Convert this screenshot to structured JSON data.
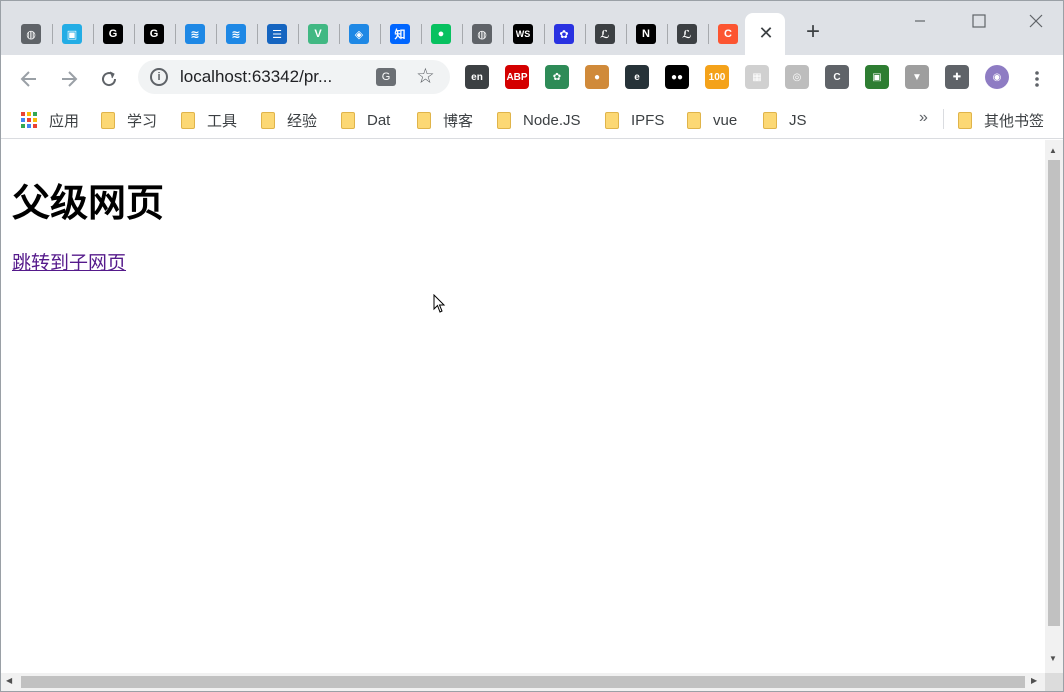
{
  "browser": {
    "tabs": [
      {
        "icon": "globe-icon",
        "color": "#5f6368",
        "glyph": "◍"
      },
      {
        "icon": "bilibili-icon",
        "color": "#23ade5",
        "glyph": "▣"
      },
      {
        "icon": "github-icon",
        "color": "#000000",
        "glyph": "G"
      },
      {
        "icon": "github-icon",
        "color": "#000000",
        "glyph": "G"
      },
      {
        "icon": "layers-icon",
        "color": "#1e88e5",
        "glyph": "≋"
      },
      {
        "icon": "layers-icon",
        "color": "#1e88e5",
        "glyph": "≋"
      },
      {
        "icon": "list-icon",
        "color": "#1565c0",
        "glyph": "☰"
      },
      {
        "icon": "vue-icon",
        "color": "#41b883",
        "glyph": "V"
      },
      {
        "icon": "cube-icon",
        "color": "#1e88e5",
        "glyph": "◈"
      },
      {
        "icon": "zhihu-icon",
        "color": "#0066ff",
        "glyph": "知"
      },
      {
        "icon": "wechat-icon",
        "color": "#07c160",
        "glyph": "●"
      },
      {
        "icon": "globe-icon",
        "color": "#5f6368",
        "glyph": "◍"
      },
      {
        "icon": "webstorm-icon",
        "color": "#000000",
        "glyph": "WS"
      },
      {
        "icon": "baidu-icon",
        "color": "#2932e1",
        "glyph": "✿"
      },
      {
        "icon": "script-icon",
        "color": "#3c4043",
        "glyph": "ℒ"
      },
      {
        "icon": "nodejs-icon",
        "color": "#000000",
        "glyph": "N"
      },
      {
        "icon": "script-icon",
        "color": "#3c4043",
        "glyph": "ℒ"
      },
      {
        "icon": "csdn-icon",
        "color": "#fc5531",
        "glyph": "C"
      }
    ],
    "address": {
      "url": "localhost:63342/pr..."
    },
    "extensions": [
      {
        "icon": "translate-en-icon",
        "color": "#3c4043",
        "glyph": "en"
      },
      {
        "icon": "adblock-plus-icon",
        "color": "#d40000",
        "glyph": "ABP"
      },
      {
        "icon": "paw-icon",
        "color": "#2e8b57",
        "glyph": "✿"
      },
      {
        "icon": "cookie-icon",
        "color": "#d08a3a",
        "glyph": "●"
      },
      {
        "icon": "e-icon",
        "color": "#263238",
        "glyph": "e"
      },
      {
        "icon": "tampermonkey-icon",
        "color": "#000000",
        "glyph": "●●"
      },
      {
        "icon": "rss-icon",
        "color": "#f4a21a",
        "glyph": "100"
      },
      {
        "icon": "grid-icon",
        "color": "#d0d0d0",
        "glyph": "▦"
      },
      {
        "icon": "circle-icon",
        "color": "#bdbdbd",
        "glyph": "◎"
      },
      {
        "icon": "c-icon",
        "color": "#5f6368",
        "glyph": "C"
      },
      {
        "icon": "qr-icon",
        "color": "#2e7d32",
        "glyph": "▣"
      },
      {
        "icon": "vue-devtools-icon",
        "color": "#9e9e9e",
        "glyph": "▼"
      },
      {
        "icon": "puzzle-icon",
        "color": "#5f6368",
        "glyph": "✚"
      },
      {
        "icon": "avatar-icon",
        "color": "#8e7cc3",
        "glyph": "◉"
      }
    ],
    "bookmarks": {
      "apps_label": "应用",
      "items": [
        "学习",
        "工具",
        "经验",
        "Dat",
        "博客",
        "Node.JS",
        "IPFS",
        "vue",
        "JS"
      ],
      "more": "»",
      "other_label": "其他书签"
    }
  },
  "page": {
    "heading": "父级网页",
    "link_text": "跳转到子网页"
  }
}
